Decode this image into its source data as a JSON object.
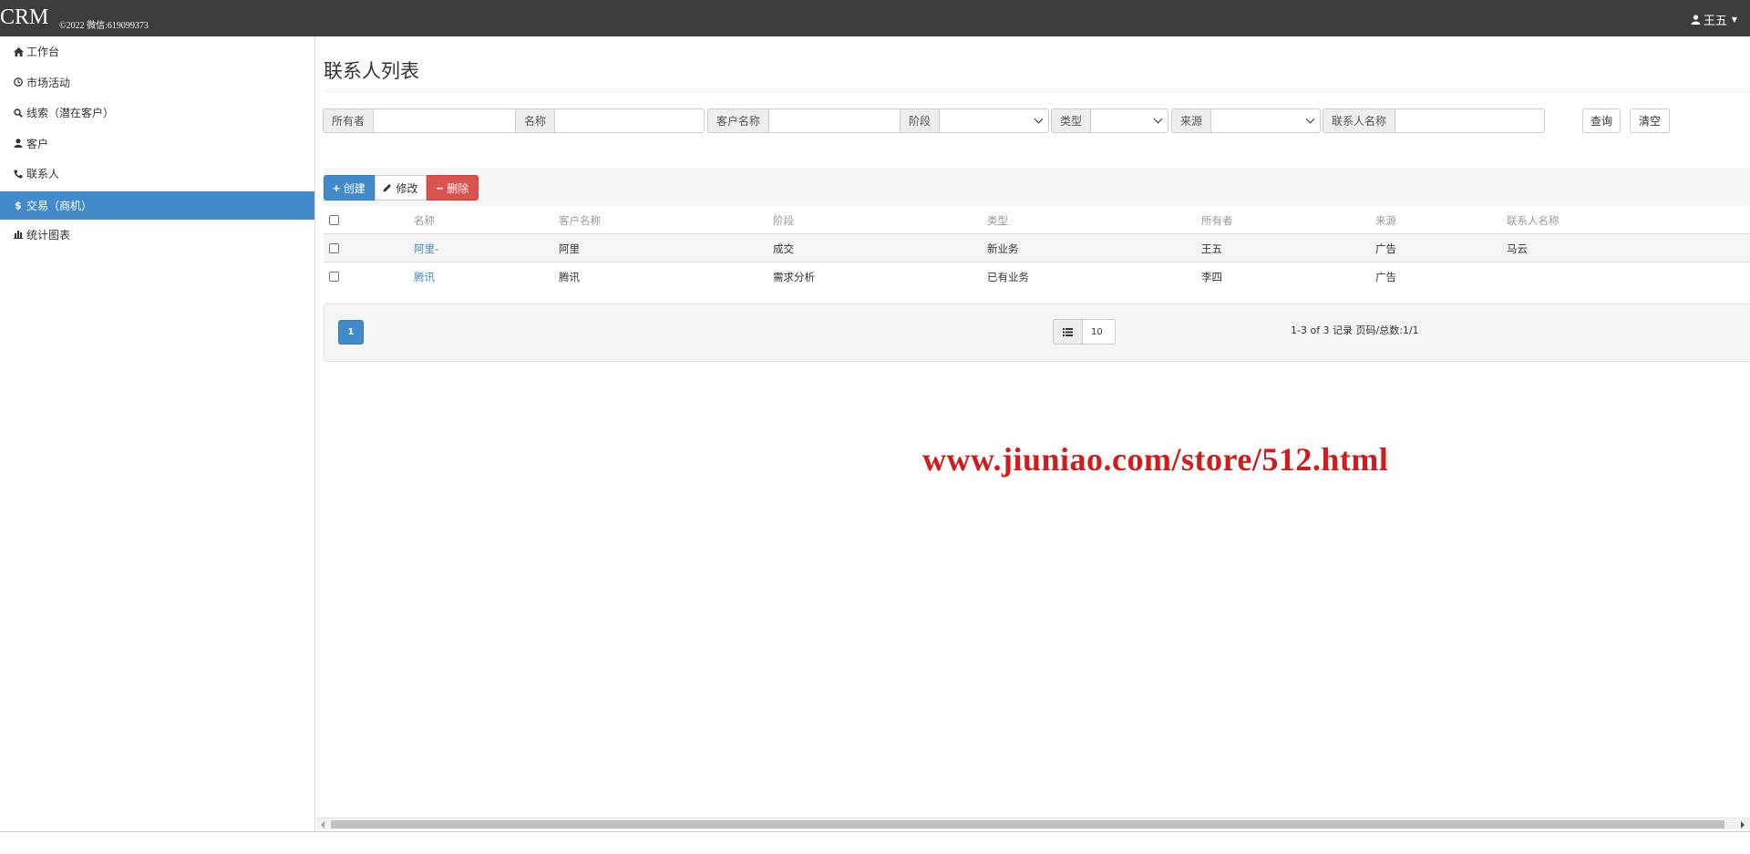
{
  "header": {
    "brand": "CRM",
    "brand_sub": "©2022 微信:619099373",
    "user_name": "王五"
  },
  "sidebar": {
    "items": [
      {
        "label": "工作台",
        "icon": "home-icon"
      },
      {
        "label": "市场活动",
        "icon": "clock-icon"
      },
      {
        "label": "线索（潜在客户）",
        "icon": "search-icon"
      },
      {
        "label": "客户",
        "icon": "user-icon"
      },
      {
        "label": "联系人",
        "icon": "phone-icon"
      },
      {
        "label": "交易（商机）",
        "icon": "dollar-icon",
        "active": true
      },
      {
        "label": "统计图表",
        "icon": "bar-chart-icon"
      }
    ]
  },
  "main": {
    "title": "联系人列表",
    "filters": {
      "owner": "所有者",
      "name": "名称",
      "customer_name": "客户名称",
      "stage": "阶段",
      "type": "类型",
      "source": "来源",
      "contact_name": "联系人名称",
      "query_button": "查询",
      "clear_button": "清空"
    },
    "toolbar": {
      "create": "创建",
      "edit": "修改",
      "delete": "删除"
    },
    "table": {
      "headers": [
        "名称",
        "客户名称",
        "阶段",
        "类型",
        "所有者",
        "来源",
        "联系人名称"
      ],
      "rows": [
        [
          "阿里-",
          "阿里",
          "成交",
          "新业务",
          "王五",
          "广告",
          "马云"
        ],
        [
          "腾讯",
          "腾讯",
          "需求分析",
          "已有业务",
          "李四",
          "广告",
          ""
        ]
      ]
    },
    "pager": {
      "current_page": "1",
      "page_size": "10",
      "info": "1-3 of 3 记录 页码/总数:1/1"
    },
    "watermark": "www.jiuniao.com/store/512.html"
  },
  "colors": {
    "topbar": "#3c3c3c",
    "primary": "#428bca",
    "danger": "#d9534f",
    "watermark": "#d21b1b"
  }
}
